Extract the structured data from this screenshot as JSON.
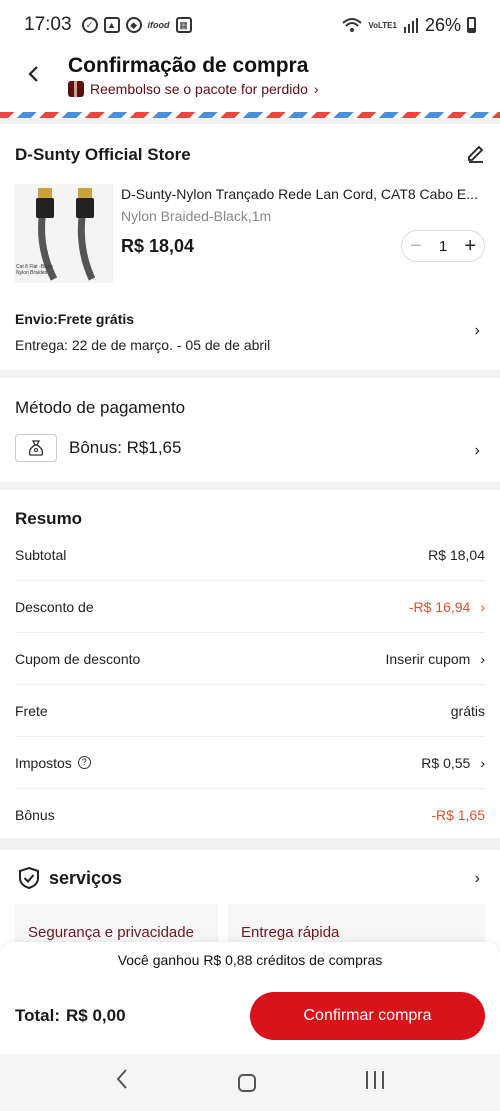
{
  "status_bar": {
    "time": "17:03",
    "left_icons": [
      "check-circle-icon",
      "image-icon",
      "nfc-icon",
      "ifood-icon",
      "qr-icon"
    ],
    "ifood_text": "ifood",
    "network": "VoLTE1",
    "battery": "26%"
  },
  "header": {
    "title": "Confirmação de compra",
    "refund_text": "Reembolso se o pacote for perdido",
    "refund_chevron": "›"
  },
  "store": {
    "name": "D-Sunty Official Store",
    "product": {
      "name": "D-Sunty-Nylon Trançado Rede Lan Cord, CAT8 Cabo E...",
      "variant": "Nylon Braided-Black,1m",
      "price": "R$ 18,04",
      "quantity": "1",
      "image_caption_1": "Cat 8 Flat -Black",
      "image_caption_2": "Nylon Braided"
    },
    "shipping_title": "Envio:Frete grátis",
    "delivery": "Entrega: 22 de de março. - 05 de de abril"
  },
  "payment": {
    "title": "Método de pagamento",
    "bonus_label": "Bônus: R$1,65"
  },
  "summary": {
    "title": "Resumo",
    "rows": [
      {
        "label": "Subtotal",
        "value": "R$ 18,04"
      },
      {
        "label": "Desconto de",
        "value": "-R$ 16,94"
      },
      {
        "label": "Cupom de desconto",
        "value": "Inserir cupom"
      },
      {
        "label": "Frete",
        "value": "grátis"
      },
      {
        "label": "Impostos",
        "value": "R$ 0,55"
      },
      {
        "label": "Bônus",
        "value": "-R$ 1,65"
      }
    ]
  },
  "services": {
    "title": "serviços",
    "items": [
      "Segurança e privacidade",
      "Entrega rápida"
    ]
  },
  "bottom": {
    "credits": "Você ganhou R$ 0,88 créditos de compras",
    "total_label": "Total:",
    "total_value": "R$ 0,00",
    "confirm_label": "Confirmar compra"
  },
  "colors": {
    "accent_red": "#d8131c",
    "discount_red": "#e0502d",
    "brand_dark": "#5b0f16"
  }
}
